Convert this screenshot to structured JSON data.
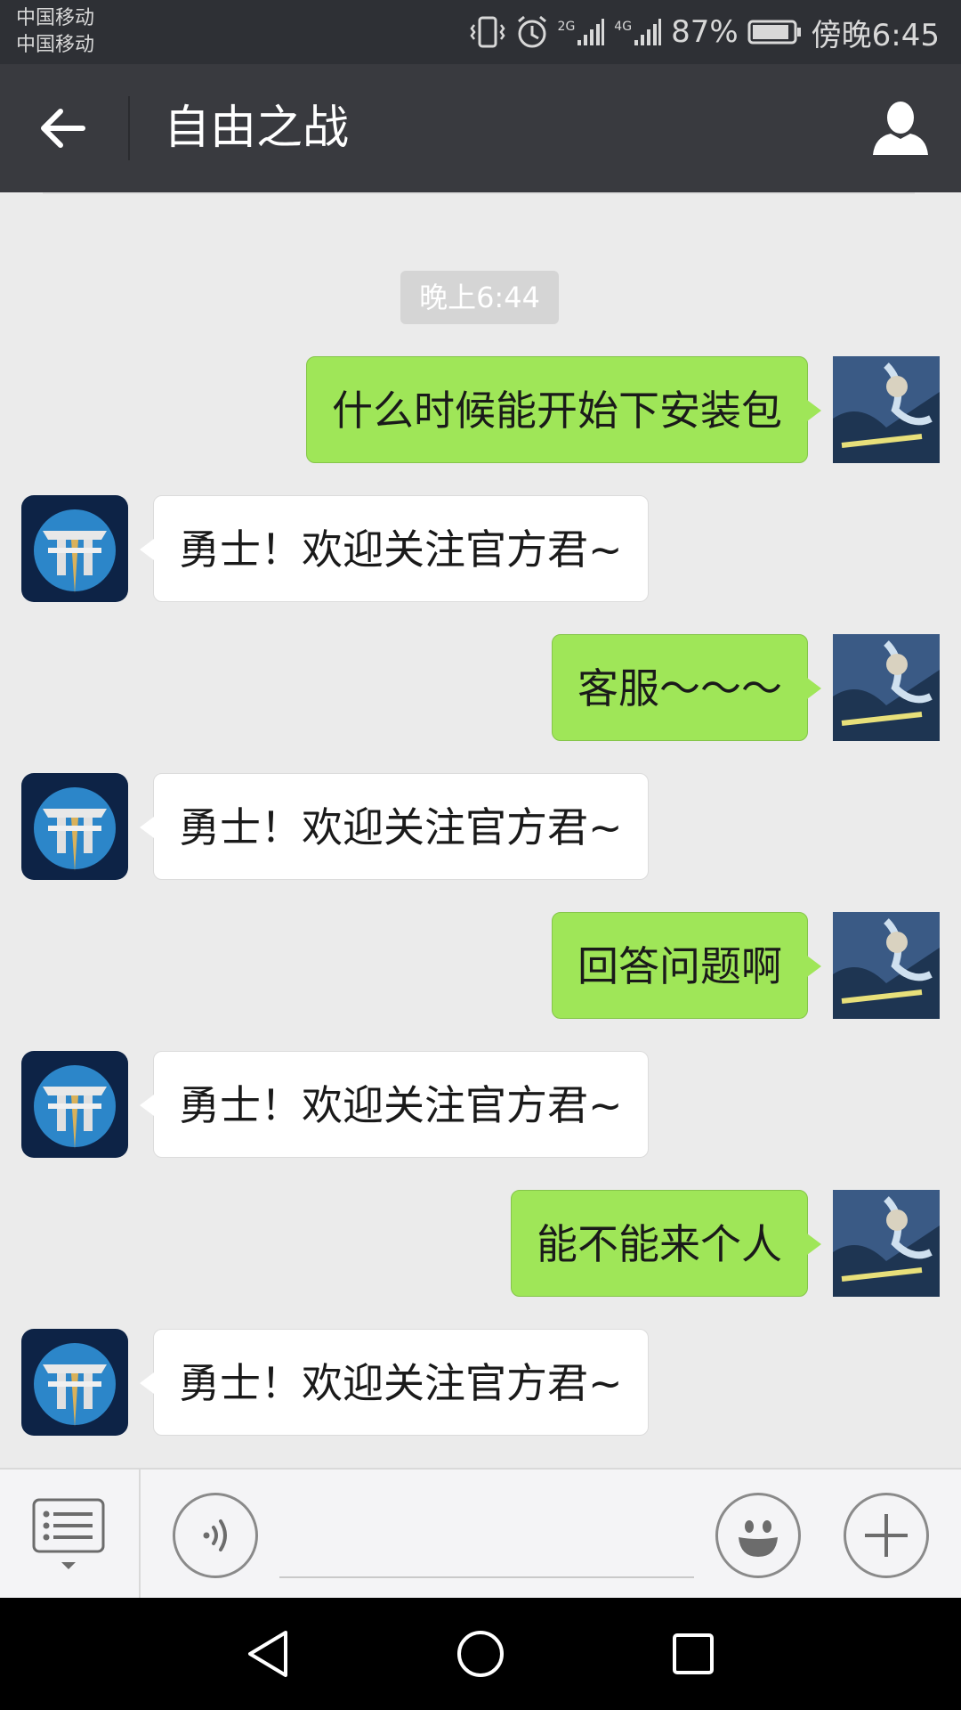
{
  "status_bar": {
    "carrier_1": "中国移动",
    "carrier_2": "中国移动",
    "network_1": "2G",
    "network_2": "4G",
    "battery": "87%",
    "time": "傍晚6:45"
  },
  "header": {
    "title": "自由之战",
    "icons": {
      "back": "back-arrow-icon",
      "profile": "person-icon"
    }
  },
  "chat": {
    "timestamp": "晚上6:44",
    "messages": [
      {
        "side": "out",
        "text": "什么时候能开始下安装包"
      },
      {
        "side": "in",
        "text": "勇士！欢迎关注官方君~"
      },
      {
        "side": "out",
        "text": "客服～～～"
      },
      {
        "side": "in",
        "text": "勇士！欢迎关注官方君~"
      },
      {
        "side": "out",
        "text": "回答问题啊"
      },
      {
        "side": "in",
        "text": "勇士！欢迎关注官方君~"
      },
      {
        "side": "out",
        "text": "能不能来个人"
      },
      {
        "side": "in",
        "text": "勇士！欢迎关注官方君~"
      }
    ]
  },
  "input_bar": {
    "text_value": "",
    "icons": {
      "menu": "menu-list-icon",
      "voice": "voice-icon",
      "emoji": "smiley-icon",
      "more": "plus-icon"
    }
  },
  "colors": {
    "title_bar": "#393a3f",
    "status_bar": "#2e3035",
    "chat_bg": "#ebebeb",
    "outgoing_bubble": "#9fe658",
    "incoming_bubble": "#ffffff"
  }
}
